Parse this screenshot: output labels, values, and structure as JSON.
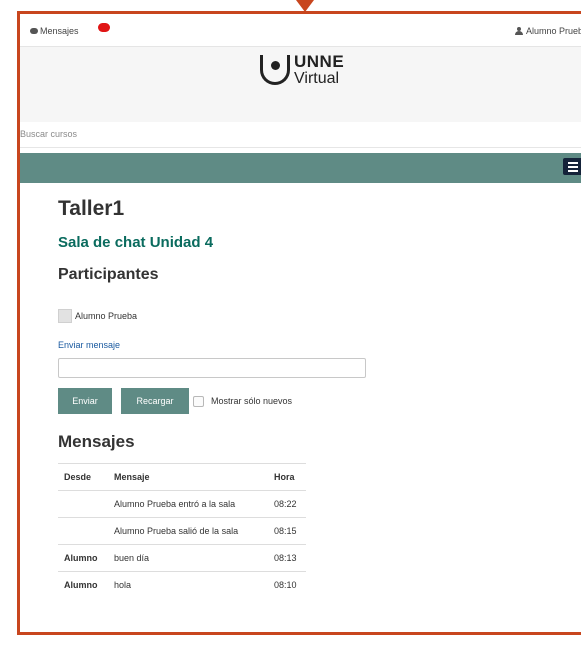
{
  "topbar": {
    "messages_label": "Mensajes",
    "user_label": "Alumno Prueb"
  },
  "brand": {
    "line1": "UNNE",
    "line2": "Virtual"
  },
  "search": {
    "placeholder": "Buscar cursos"
  },
  "course": {
    "title": "Taller1",
    "activity": "Sala de chat Unidad 4"
  },
  "participants": {
    "heading": "Participantes",
    "items": [
      {
        "name": "Alumno Prueba"
      }
    ]
  },
  "compose": {
    "label": "Enviar mensaje",
    "send_button": "Enviar",
    "reload_button": "Recargar",
    "only_new_label": "Mostrar sólo nuevos"
  },
  "messages": {
    "heading": "Mensajes",
    "columns": [
      "Desde",
      "Mensaje",
      "Hora"
    ],
    "rows": [
      {
        "from": "",
        "text": "Alumno Prueba entró a la sala",
        "time": "08:22"
      },
      {
        "from": "",
        "text": "Alumno Prueba salió de la sala",
        "time": "08:15"
      },
      {
        "from": "Alumno",
        "text": "buen día",
        "time": "08:13"
      },
      {
        "from": "Alumno",
        "text": "hola",
        "time": "08:10"
      }
    ]
  },
  "colors": {
    "accent": "#5f8b85",
    "frame": "#c8461e",
    "activity_title": "#0a6b5e",
    "badge": "#e01515"
  }
}
